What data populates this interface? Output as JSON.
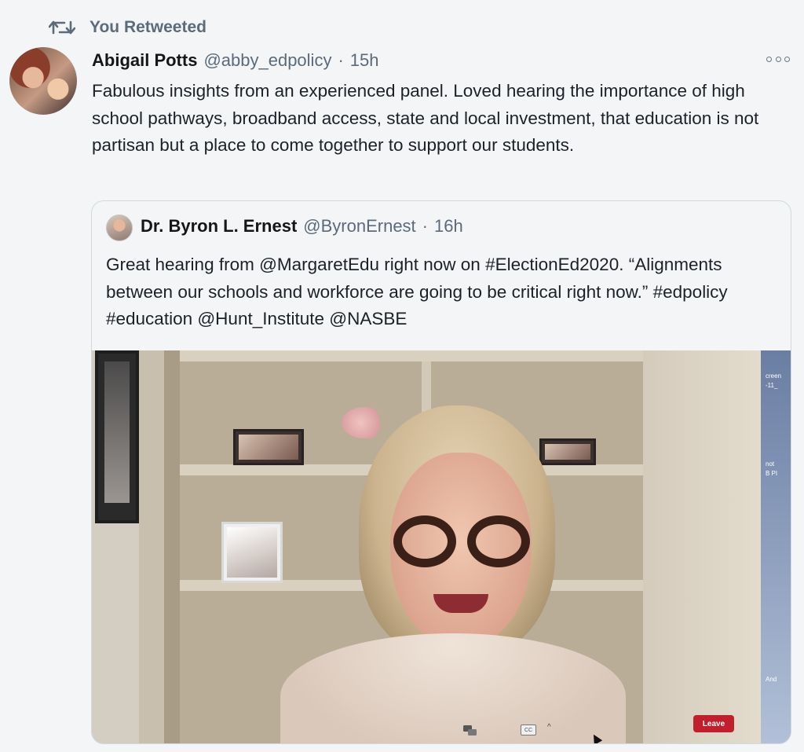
{
  "retweet": {
    "label": "You Retweeted"
  },
  "tweet": {
    "author_name": "Abigail Potts",
    "author_handle": "@abby_edpolicy",
    "separator": "·",
    "time": "15h",
    "text": "Fabulous insights from an experienced panel.  Loved hearing the importance of high school pathways, broadband access, state and local investment, that education is not partisan but a place to come together to support our students."
  },
  "quoted": {
    "author_name": "Dr. Byron L. Ernest",
    "author_handle": "@ByronErnest",
    "separator": "·",
    "time": "16h",
    "text": "Great hearing from @MargaretEdu right now on #ElectionEd2020. “Alignments between our schools and workforce are going to be critical right now.” #edpolicy #education @Hunt_Institute @NASBE"
  },
  "video_call": {
    "leave_label": "Leave",
    "cc_label": "CC",
    "side_texts": [
      "creen",
      "-11_",
      "not",
      "B PI",
      "And"
    ]
  },
  "icons": {
    "retweet": "retweet-icon",
    "more": "more-options-icon",
    "chat": "chat-icon",
    "caret": "caret-up-icon",
    "cursor": "mouse-cursor-icon"
  },
  "colors": {
    "background": "#f4f5f7",
    "secondary_text": "#5b6b7a",
    "border": "#cfd9de",
    "leave_button": "#c21f2c"
  }
}
